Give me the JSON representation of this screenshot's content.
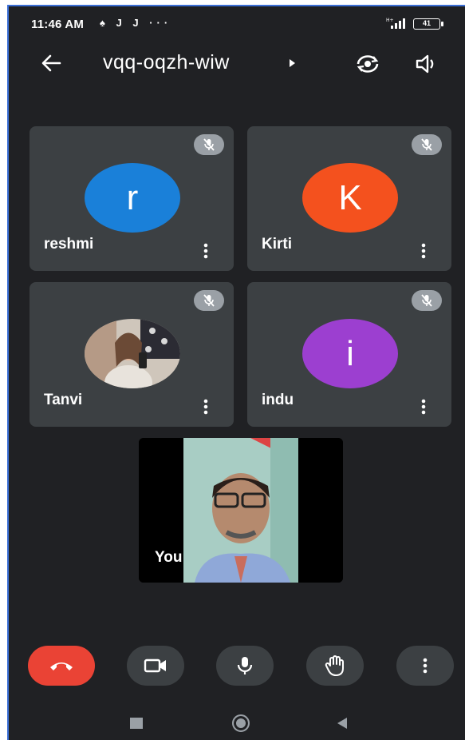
{
  "status_bar": {
    "time": "11:46 AM",
    "notif_icons": "♠ J J ···",
    "battery": "41"
  },
  "header": {
    "meeting_code": "vqq-oqzh-wiw"
  },
  "participants": [
    {
      "name": "reshmi",
      "initial": "r",
      "color": "#1a80d9"
    },
    {
      "name": "Kirti",
      "initial": "K",
      "color": "#f4511e"
    },
    {
      "name": "Tanvi",
      "initial": "",
      "color": "#c9c2b8"
    },
    {
      "name": "indu",
      "initial": "i",
      "color": "#9c3fd0"
    }
  ],
  "self_view": {
    "label": "You"
  },
  "controls": [
    "end-call",
    "camera",
    "microphone",
    "raise-hand",
    "more-options"
  ],
  "colors": {
    "background": "#202124",
    "tile": "#3c4043",
    "end_call": "#ea4335",
    "mute_badge": "#9aa0a6"
  }
}
